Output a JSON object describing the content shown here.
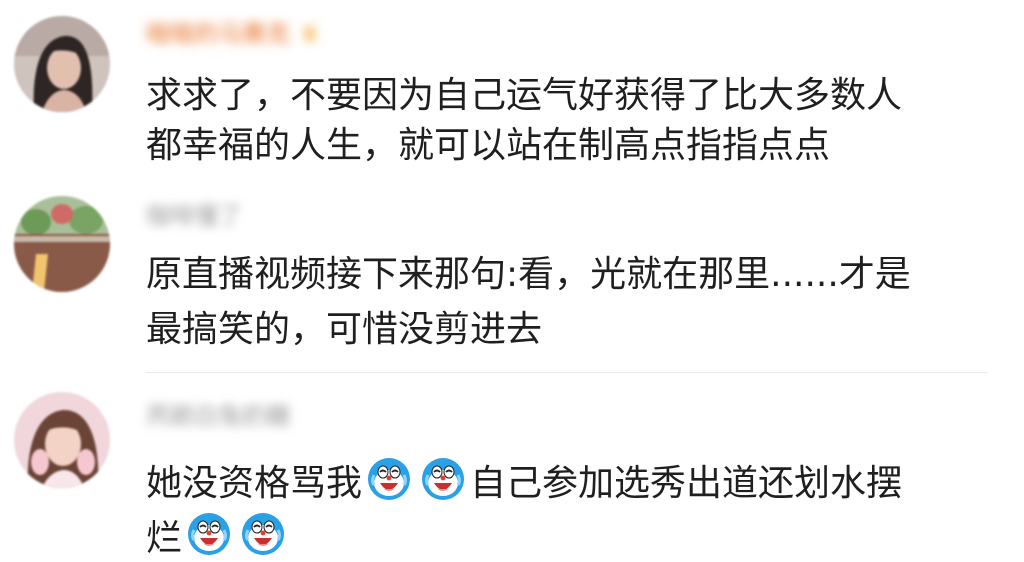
{
  "comments": [
    {
      "username": "暗暗的马赛克",
      "username_color": "#e8742a",
      "has_crown_badge": true,
      "avatar_icon": "avatar-girl-dark-hair",
      "lines": [
        "求求了，不要因为自己运气好获得了比大多数人",
        "都幸福的人生，就可以站在制高点指指点点"
      ]
    },
    {
      "username": "咖啡懂了",
      "username_color": "#9a9a9a",
      "has_crown_badge": false,
      "avatar_icon": "avatar-plants-dome",
      "lines": [
        "原直播视频接下来那句:看，光就在那里......才是",
        "最搞笑的，可惜没剪进去"
      ]
    },
    {
      "username": "芮颖白兔奶糖",
      "username_color": "#9a9a9a",
      "has_crown_badge": false,
      "avatar_icon": "avatar-girl-pink",
      "line1_part1": "她没资格骂我",
      "line1_part2": "自己参加选秀出道还划水摆",
      "line2_part1": "烂",
      "emoji_icon": "doraemon-crying-laugh-emoji"
    }
  ]
}
